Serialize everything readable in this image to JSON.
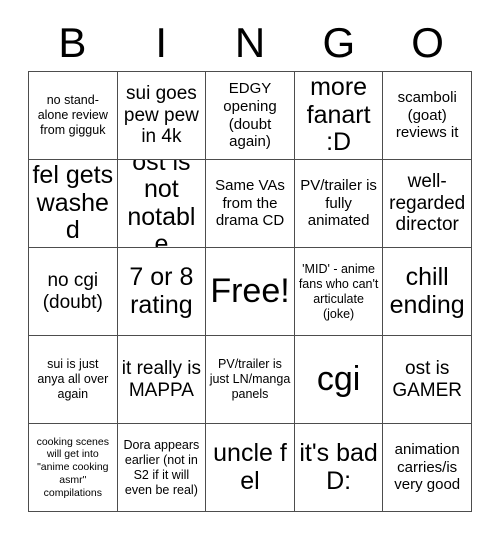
{
  "card": {
    "header_letters": [
      "B",
      "I",
      "N",
      "G",
      "O"
    ],
    "free_space_label": "Free!",
    "colors": {
      "background": "#ffffff",
      "grid_line": "#4d4d4d",
      "text": "#000000"
    },
    "rows": [
      [
        {
          "text": "no stand-alone review from gigguk",
          "size": "fs-sm"
        },
        {
          "text": "sui goes pew pew in 4k",
          "size": "fs-lg"
        },
        {
          "text": "EDGY opening (doubt again)",
          "size": "fs-md"
        },
        {
          "text": "more fanart :D",
          "size": "fs-xl"
        },
        {
          "text": "scamboli (goat) reviews it",
          "size": "fs-md"
        }
      ],
      [
        {
          "text": "fel gets washed",
          "size": "fs-xl"
        },
        {
          "text": "ost is not notable",
          "size": "fs-xl"
        },
        {
          "text": "Same VAs from the drama CD",
          "size": "fs-md"
        },
        {
          "text": "PV/trailer is fully animated",
          "size": "fs-md"
        },
        {
          "text": "well-regarded director",
          "size": "fs-lg"
        }
      ],
      [
        {
          "text": "no cgi (doubt)",
          "size": "fs-lg"
        },
        {
          "text": "7 or 8 rating",
          "size": "fs-xl"
        },
        {
          "text": "Free!",
          "size": "fs-xxl"
        },
        {
          "text": "'MID' - anime fans who can't articulate (joke)",
          "size": "fs-sm"
        },
        {
          "text": "chill ending",
          "size": "fs-xl"
        }
      ],
      [
        {
          "text": "sui is just anya all over again",
          "size": "fs-sm"
        },
        {
          "text": "it really is MAPPA",
          "size": "fs-lg"
        },
        {
          "text": "PV/trailer is just LN/manga panels",
          "size": "fs-sm"
        },
        {
          "text": "cgi",
          "size": "fs-xxl"
        },
        {
          "text": "ost is GAMER",
          "size": "fs-lg"
        }
      ],
      [
        {
          "text": "cooking scenes will get into \"anime cooking asmr\" compilations",
          "size": "fs-xs"
        },
        {
          "text": "Dora appears earlier (not in S2 if it will even be real)",
          "size": "fs-sm"
        },
        {
          "text": "uncle f el",
          "size": "fs-xl"
        },
        {
          "text": "it's bad D:",
          "size": "fs-xl"
        },
        {
          "text": "animation carries/is very good",
          "size": "fs-md"
        }
      ]
    ]
  }
}
